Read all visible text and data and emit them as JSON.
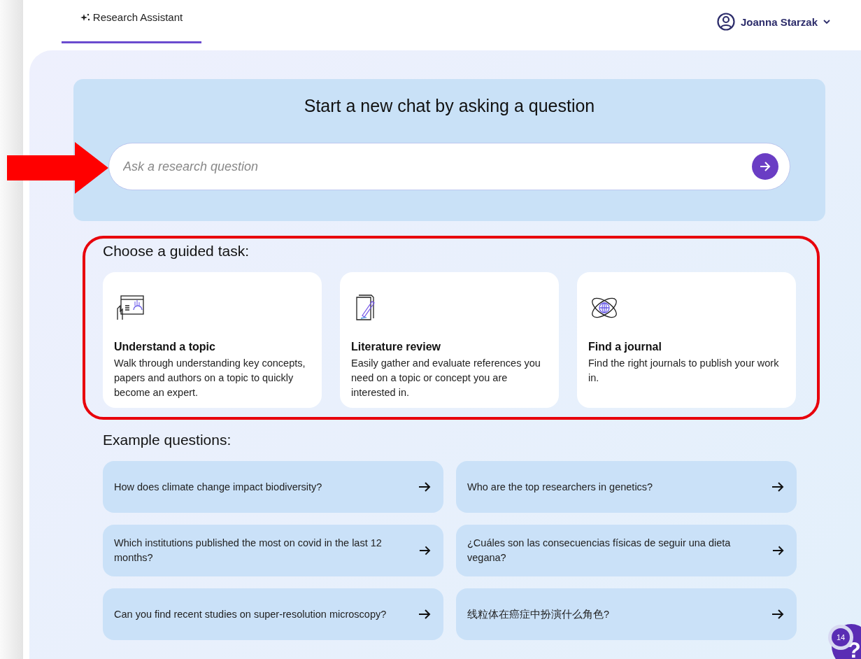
{
  "header": {
    "tabs": [
      {
        "label": "Research Assistant",
        "selected": true
      }
    ],
    "user": {
      "name": "Joanna Starzak"
    }
  },
  "hero": {
    "title": "Start a new chat by asking a question",
    "search": {
      "placeholder": "Ask a research question"
    }
  },
  "guided": {
    "heading": "Choose a guided task:",
    "tasks": [
      {
        "kind": "topic",
        "title": "Understand a topic",
        "description": "Walk through understanding key concepts, papers and authors on a topic to quickly become an expert."
      },
      {
        "kind": "review",
        "title": "Literature review",
        "description": "Easily gather and evaluate references you need on a topic or concept you are interested in."
      },
      {
        "kind": "journal",
        "title": "Find a journal",
        "description": "Find the right journals to publish your work in."
      }
    ]
  },
  "examples": {
    "heading": "Example questions:",
    "questions": [
      "How does climate change impact biodiversity?",
      "Who are the top researchers in genetics?",
      "Which institutions published the most on covid in the last 12 months?",
      "¿Cuáles son las consecuencias físicas de seguir una dieta vegana?",
      "Can you find recent studies on super-resolution microscopy?",
      "线粒体在癌症中扮演什么角色?"
    ]
  },
  "help": {
    "badge": "14",
    "label": "?"
  }
}
